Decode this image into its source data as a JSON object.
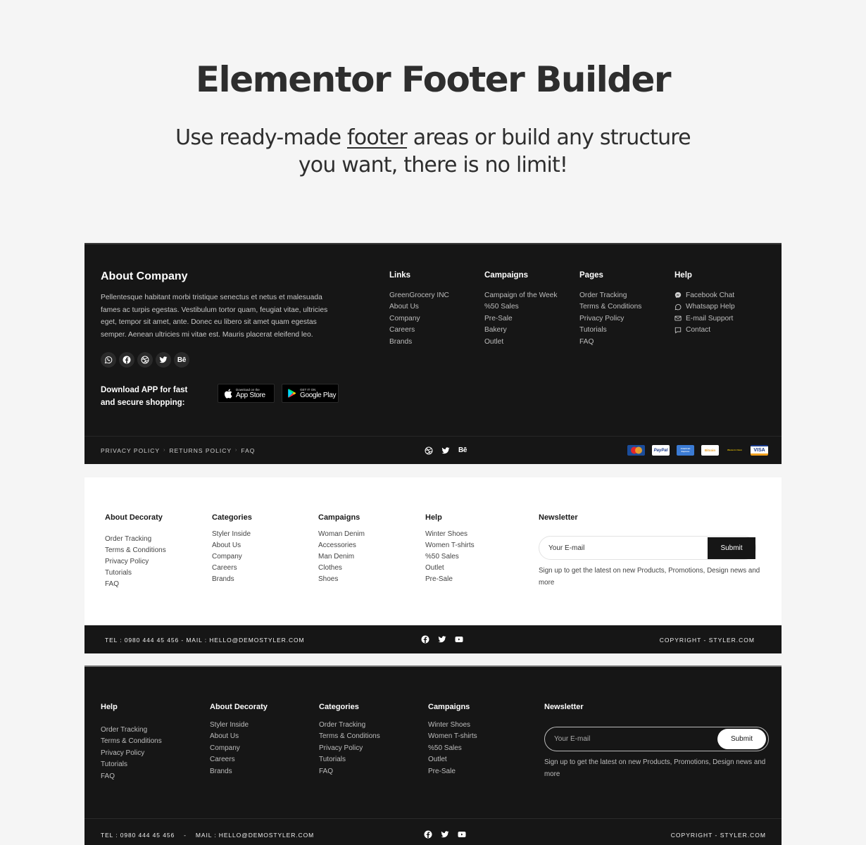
{
  "hero": {
    "title": "Elementor Footer Builder",
    "subtitle_pre": "Use ready-made ",
    "subtitle_link": "footer",
    "subtitle_post": " areas or build any structure",
    "subtitle_line2": "you want, there is no limit!"
  },
  "footer1": {
    "about_title": "About Company",
    "about_text": "Pellentesque habitant morbi tristique senectus et netus et malesuada fames ac turpis egestas. Vestibulum tortor quam, feugiat vitae, ultricies eget, tempor sit amet, ante. Donec eu libero sit amet quam egestas semper. Aenean ultricies mi vitae est. Mauris placerat eleifend leo.",
    "socials": [
      "whatsapp-icon",
      "facebook-icon",
      "dribbble-icon",
      "twitter-icon",
      "behance-icon"
    ],
    "behance_label": "Bē",
    "download_text": "Download APP for fast and secure shopping:",
    "appstore": {
      "small": "Download on the",
      "big": "App Store"
    },
    "googleplay": {
      "small": "GET IT ON",
      "big": "Google Play"
    },
    "columns": [
      {
        "title": "Links",
        "items": [
          "GreenGrocery INC",
          "About Us",
          "Company",
          "Careers",
          "Brands"
        ]
      },
      {
        "title": "Campaigns",
        "items": [
          "Campaign of the Week",
          "%50 Sales",
          "Pre-Sale",
          "Bakery",
          "Outlet"
        ]
      },
      {
        "title": "Pages",
        "items": [
          "Order Tracking",
          "Terms & Conditions",
          "Privacy Policy",
          "Tutorials",
          "FAQ"
        ]
      },
      {
        "title": "Help",
        "items": [
          "Facebook Chat",
          "Whatsapp Help",
          "E-mail Support",
          "Contact"
        ],
        "icons": [
          "messenger-icon",
          "whatsapp-icon",
          "mail-icon",
          "chat-icon"
        ]
      }
    ],
    "legal": [
      "PRIVACY POLICY",
      "RETURNS POLICY",
      "FAQ"
    ],
    "legal_sep": "›",
    "payments": [
      "MasterCard",
      "PayPal",
      "American Express",
      "Bitcoin",
      "Western Union",
      "VISA"
    ]
  },
  "footer2": {
    "columns": [
      {
        "title": "About Decoraty",
        "items": [
          "Order Tracking",
          "Terms & Conditions",
          "Privacy Policy",
          "Tutorials",
          "FAQ"
        ]
      },
      {
        "title": "Categories",
        "items": [
          "Styler Inside",
          "About Us",
          "Company",
          "Careers",
          "Brands"
        ]
      },
      {
        "title": "Campaigns",
        "items": [
          "Woman Denim",
          "Accessories",
          "Man Denim",
          "Clothes",
          "Shoes"
        ]
      },
      {
        "title": "Help",
        "items": [
          "Winter Shoes",
          "Women T-shirts",
          "%50 Sales",
          "Outlet",
          "Pre-Sale"
        ]
      }
    ],
    "newsletter": {
      "title": "Newsletter",
      "placeholder": "Your E-mail",
      "submit": "Submit",
      "note": "Sign up to get the latest on new Products, Promotions, Design news and more"
    },
    "contact": "TEL : 0980 444 45 456  -  MAIL : HELLO@DEMOSTYLER.COM",
    "copyright": "COPYRIGHT - STYLER.COM"
  },
  "footer3": {
    "columns": [
      {
        "title": "Help",
        "items": [
          "Order Tracking",
          "Terms & Conditions",
          "Privacy Policy",
          "Tutorials",
          "FAQ"
        ]
      },
      {
        "title": "About Decoraty",
        "items": [
          "Styler Inside",
          "About Us",
          "Company",
          "Careers",
          "Brands"
        ]
      },
      {
        "title": "Categories",
        "items": [
          "Order Tracking",
          "Terms & Conditions",
          "Privacy Policy",
          "Tutorials",
          "FAQ"
        ]
      },
      {
        "title": "Campaigns",
        "items": [
          "Winter Shoes",
          "Women T-shirts",
          "%50 Sales",
          "Outlet",
          "Pre-Sale"
        ]
      }
    ],
    "newsletter": {
      "title": "Newsletter",
      "placeholder": "Your E-mail",
      "submit": "Submit",
      "note": "Sign up to get the latest on new Products, Promotions, Design news and more"
    },
    "contact": "TEL : 0980 444 45 456    -    MAIL : HELLO@DEMOSTYLER.COM",
    "copyright": "COPYRIGHT - STYLER.COM"
  }
}
